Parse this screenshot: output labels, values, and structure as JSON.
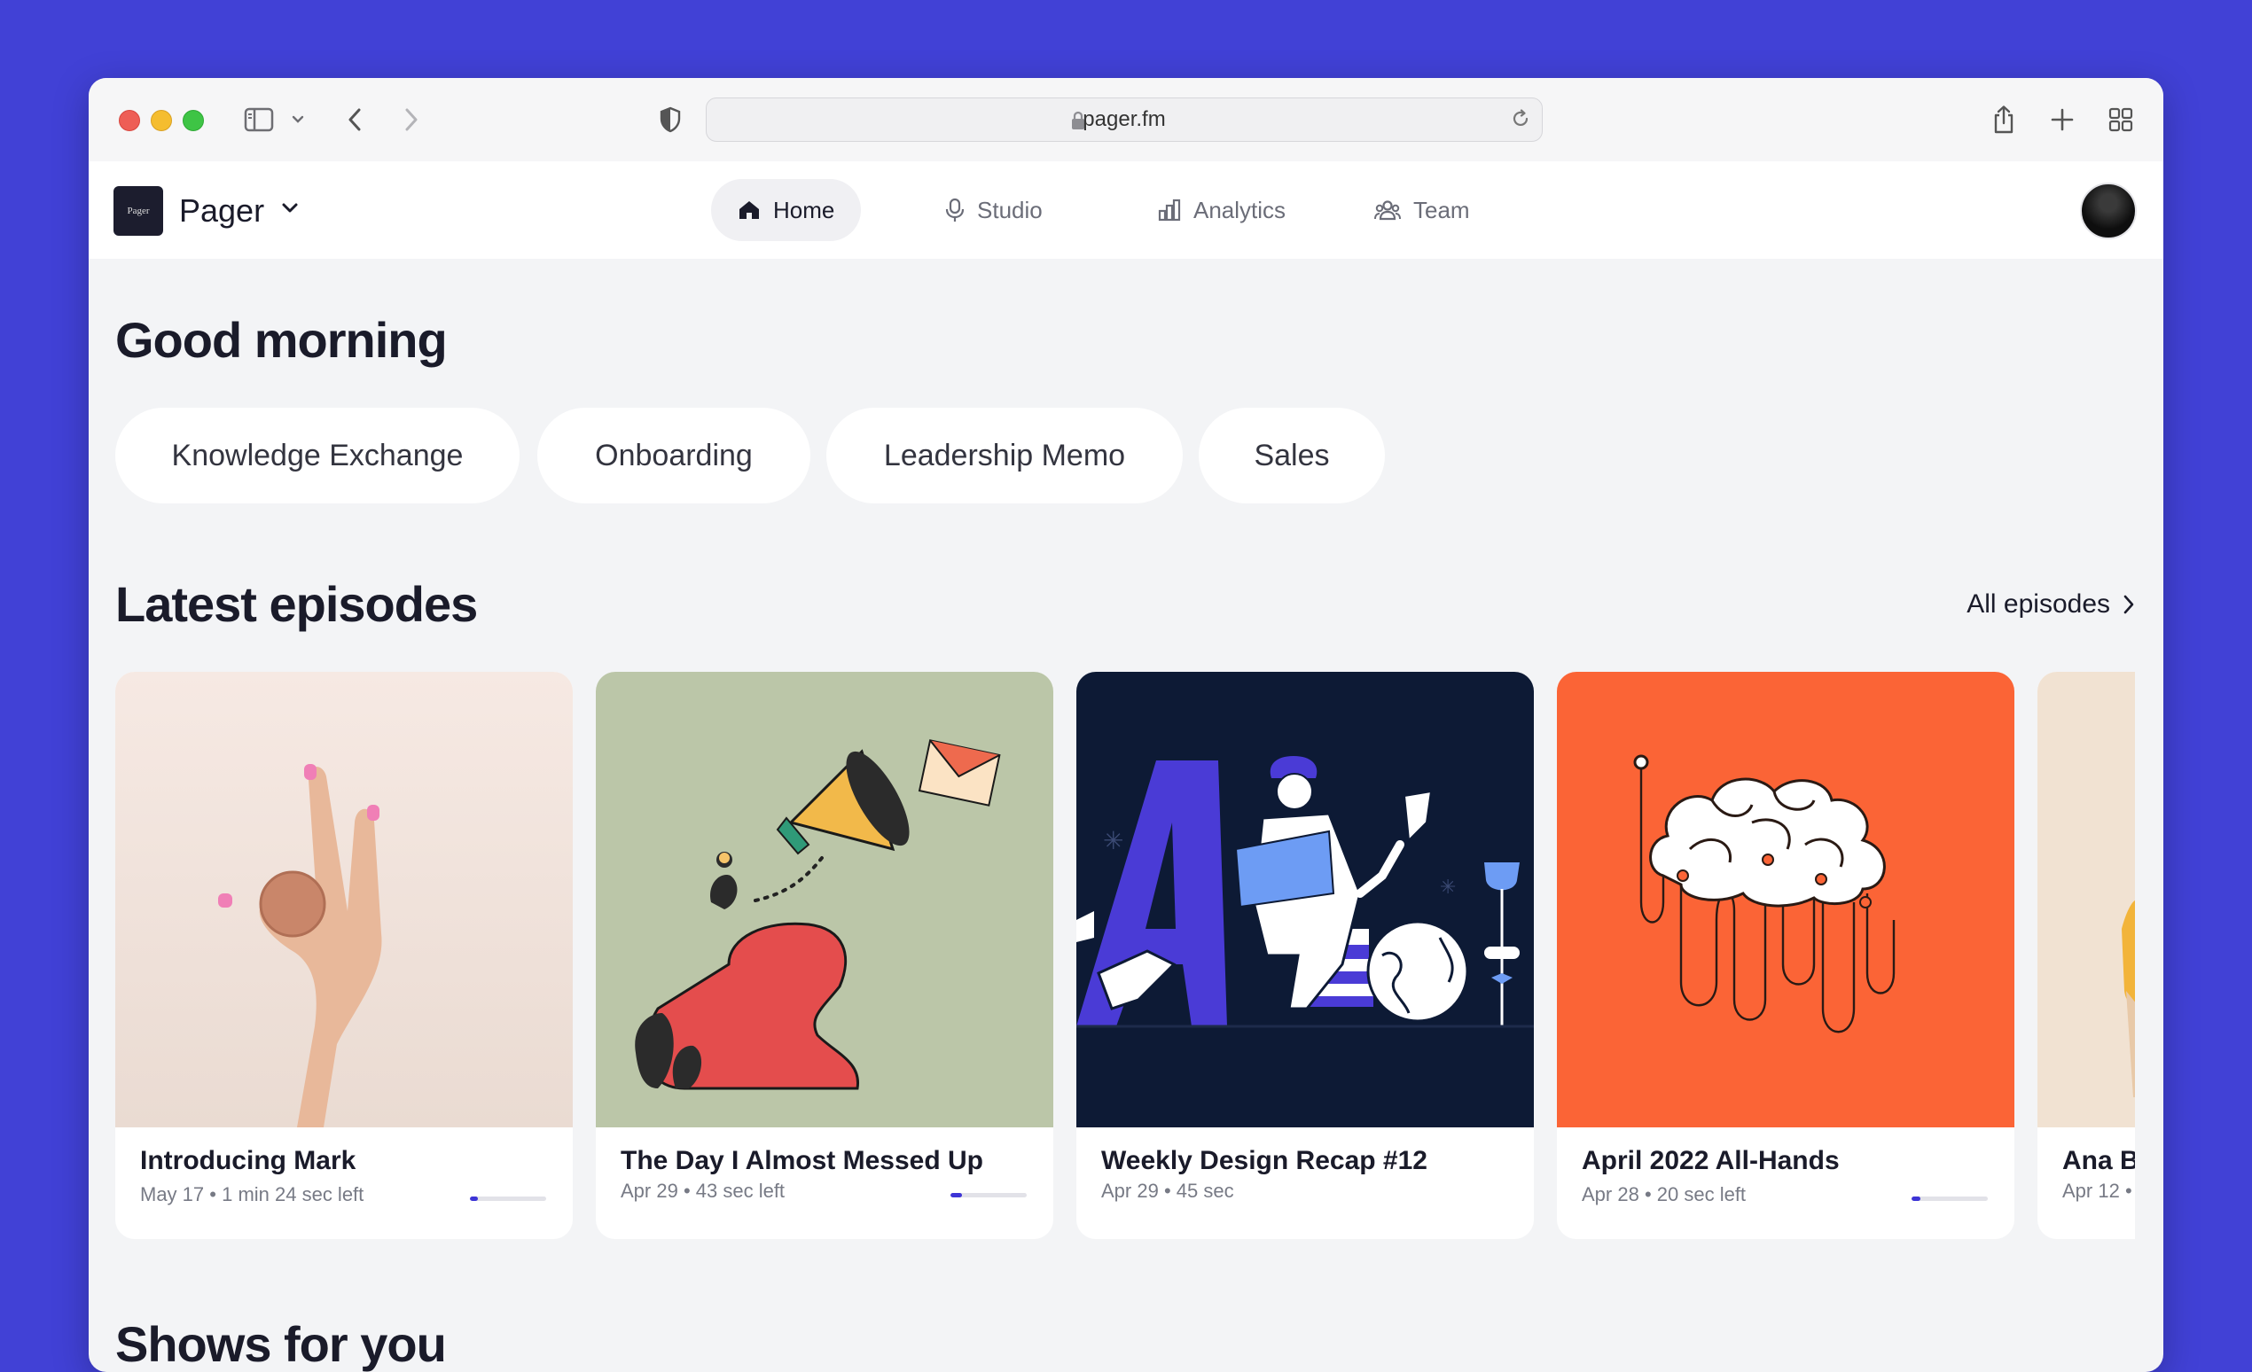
{
  "browser": {
    "url": "pager.fm"
  },
  "app": {
    "brand": "Pager",
    "logo_text": "Pager",
    "nav": [
      {
        "label": "Home",
        "icon": "home-icon",
        "active": true
      },
      {
        "label": "Studio",
        "icon": "microphone-icon",
        "active": false
      },
      {
        "label": "Analytics",
        "icon": "bar-chart-icon",
        "active": false
      },
      {
        "label": "Team",
        "icon": "team-icon",
        "active": false
      }
    ]
  },
  "main": {
    "greeting": "Good morning",
    "chips": [
      "Knowledge Exchange",
      "Onboarding",
      "Leadership Memo",
      "Sales"
    ],
    "latest": {
      "title": "Latest episodes",
      "all_link": "All episodes",
      "episodes": [
        {
          "title": "Introducing Mark",
          "date": "May 17",
          "detail": "1 min 24 sec left",
          "progress": 0.1,
          "art_bg": "#f3e6e0"
        },
        {
          "title": "The Day I Almost Messed Up",
          "date": "Apr 29",
          "detail": "43 sec left",
          "progress": 0.15,
          "art_bg": "#bbc6a8"
        },
        {
          "title": "Weekly Design Recap #12",
          "date": "Apr 29",
          "detail": "45 sec",
          "progress": null,
          "art_bg": "#0d1a35"
        },
        {
          "title": "April 2022 All-Hands",
          "date": "Apr 28",
          "detail": "20 sec left",
          "progress": 0.12,
          "art_bg": "#fb6436"
        },
        {
          "title": "Ana Bi",
          "date": "Apr 12",
          "detail": "",
          "progress": null,
          "art_bg": "#f1e2d2"
        }
      ]
    },
    "shows_title": "Shows for you"
  },
  "colors": {
    "desktop_bg": "#4141d6",
    "accent": "#3d34d6",
    "text_primary": "#1a1b2a"
  }
}
